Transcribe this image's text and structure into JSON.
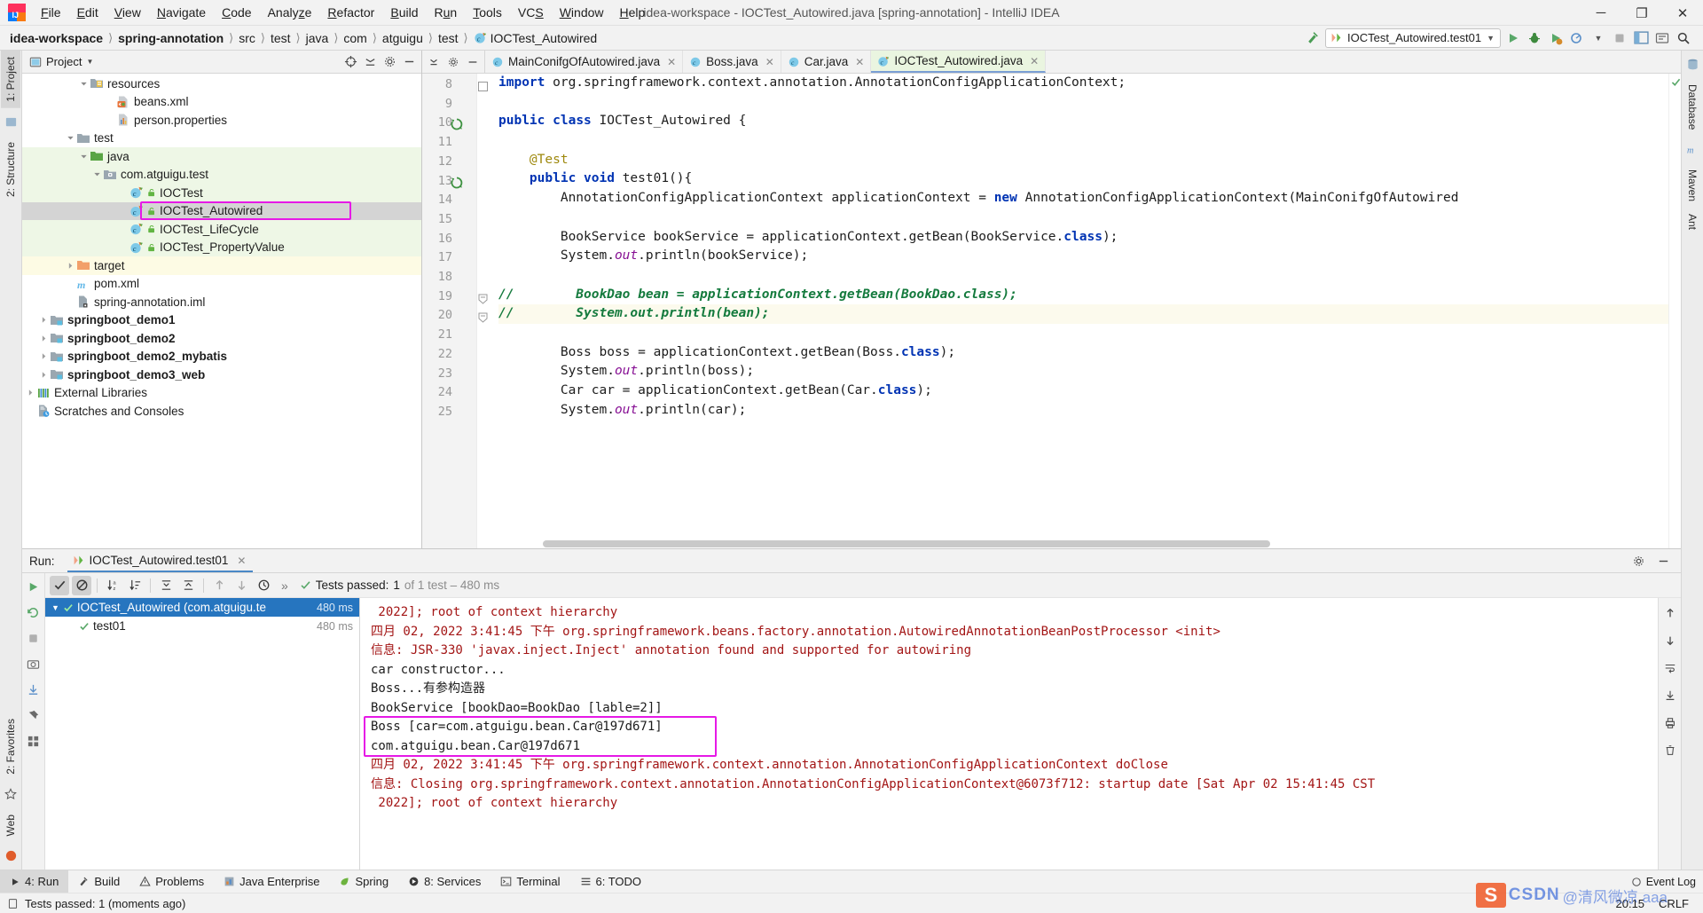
{
  "window": {
    "title": "idea-workspace - IOCTest_Autowired.java [spring-annotation] - IntelliJ IDEA",
    "minimize": "─",
    "maximize": "❐",
    "close": "✕"
  },
  "menu": [
    {
      "label": "File"
    },
    {
      "label": "Edit"
    },
    {
      "label": "View"
    },
    {
      "label": "Navigate"
    },
    {
      "label": "Code"
    },
    {
      "label": "Analyze"
    },
    {
      "label": "Refactor"
    },
    {
      "label": "Build"
    },
    {
      "label": "Run"
    },
    {
      "label": "Tools"
    },
    {
      "label": "VCS"
    },
    {
      "label": "Window"
    },
    {
      "label": "Help"
    }
  ],
  "breadcrumbs": [
    {
      "label": "idea-workspace",
      "bold": true
    },
    {
      "label": "spring-annotation",
      "bold": true
    },
    {
      "label": "src",
      "bold": false
    },
    {
      "label": "test",
      "bold": false
    },
    {
      "label": "java",
      "bold": false
    },
    {
      "label": "com",
      "bold": false
    },
    {
      "label": "atguigu",
      "bold": false
    },
    {
      "label": "test",
      "bold": false
    },
    {
      "label": "IOCTest_Autowired",
      "bold": false
    }
  ],
  "toolbar": {
    "run_config": "IOCTest_Autowired.test01",
    "icons": [
      "build-hammer-icon",
      "run-icon",
      "debug-icon",
      "run-coverage-icon",
      "profiler-icon",
      "stop-icon",
      "layout-icon",
      "settings-icon",
      "search-icon"
    ]
  },
  "left_strip": [
    {
      "label": "1: Project",
      "active": true
    },
    {
      "label": "2: Structure",
      "active": false
    },
    {
      "label": "2: Favorites",
      "active": false
    },
    {
      "label": "Web",
      "active": false
    }
  ],
  "right_strip": [
    {
      "label": "Database",
      "active": false
    },
    {
      "label": "Maven",
      "active": false
    },
    {
      "label": "Ant",
      "active": false
    }
  ],
  "bottom_strip": [
    {
      "label": "4: Run",
      "active": true
    },
    {
      "label": "Build",
      "active": false
    },
    {
      "label": "Problems",
      "active": false
    },
    {
      "label": "Java Enterprise",
      "active": false
    },
    {
      "label": "Spring",
      "active": false
    },
    {
      "label": "8: Services",
      "active": false
    },
    {
      "label": "Terminal",
      "active": false
    },
    {
      "label": "6: TODO",
      "active": false
    }
  ],
  "project": {
    "title": "Project",
    "tree": [
      {
        "label": "resources",
        "indent": 4,
        "arrow": "down",
        "icon": "folder-resources-icon",
        "bg": "white",
        "bold": false
      },
      {
        "label": "beans.xml",
        "indent": 6,
        "arrow": "none",
        "icon": "xml-file-icon",
        "bg": "white",
        "bold": false
      },
      {
        "label": "person.properties",
        "indent": 6,
        "arrow": "none",
        "icon": "properties-file-icon",
        "bg": "white",
        "bold": false
      },
      {
        "label": "test",
        "indent": 3,
        "arrow": "down",
        "icon": "folder-icon",
        "bg": "white",
        "bold": false
      },
      {
        "label": "java",
        "indent": 4,
        "arrow": "down",
        "icon": "folder-green-icon",
        "bg": "green",
        "bold": false
      },
      {
        "label": "com.atguigu.test",
        "indent": 5,
        "arrow": "down",
        "icon": "package-icon",
        "bg": "green",
        "bold": false
      },
      {
        "label": "IOCTest",
        "indent": 7,
        "arrow": "none",
        "icon": "java-test-class-icon",
        "bg": "green",
        "bold": false
      },
      {
        "label": "IOCTest_Autowired",
        "indent": 7,
        "arrow": "none",
        "icon": "java-test-class-icon",
        "bg": "selected",
        "bold": false,
        "highlight": true
      },
      {
        "label": "IOCTest_LifeCycle",
        "indent": 7,
        "arrow": "none",
        "icon": "java-test-class-icon",
        "bg": "green",
        "bold": false
      },
      {
        "label": "IOCTest_PropertyValue",
        "indent": 7,
        "arrow": "none",
        "icon": "java-test-class-icon",
        "bg": "green",
        "bold": false
      },
      {
        "label": "target",
        "indent": 3,
        "arrow": "right",
        "icon": "folder-orange-icon",
        "bg": "yellow",
        "bold": false
      },
      {
        "label": "pom.xml",
        "indent": 3,
        "arrow": "none",
        "icon": "maven-pom-icon",
        "bg": "white",
        "bold": false
      },
      {
        "label": "spring-annotation.iml",
        "indent": 3,
        "arrow": "none",
        "icon": "iml-file-icon",
        "bg": "white",
        "bold": false
      },
      {
        "label": "springboot_demo1",
        "indent": 1,
        "arrow": "right",
        "icon": "module-icon",
        "bg": "white",
        "bold": true
      },
      {
        "label": "springboot_demo2",
        "indent": 1,
        "arrow": "right",
        "icon": "module-icon",
        "bg": "white",
        "bold": true
      },
      {
        "label": "springboot_demo2_mybatis",
        "indent": 1,
        "arrow": "right",
        "icon": "module-icon",
        "bg": "white",
        "bold": true
      },
      {
        "label": "springboot_demo3_web",
        "indent": 1,
        "arrow": "right",
        "icon": "module-icon",
        "bg": "white",
        "bold": true
      },
      {
        "label": "External Libraries",
        "indent": 0,
        "arrow": "right",
        "icon": "libraries-icon",
        "bg": "white",
        "bold": false
      },
      {
        "label": "Scratches and Consoles",
        "indent": 0,
        "arrow": "none",
        "icon": "scratches-icon",
        "bg": "white",
        "bold": false
      }
    ]
  },
  "editor": {
    "tabs": [
      {
        "label": "MainConifgOfAutowired.java",
        "icon": "java-class-icon",
        "active": false
      },
      {
        "label": "Boss.java",
        "icon": "java-class-icon",
        "active": false
      },
      {
        "label": "Car.java",
        "icon": "java-class-icon",
        "active": false
      },
      {
        "label": "IOCTest_Autowired.java",
        "icon": "java-test-class-icon",
        "active": true
      }
    ],
    "first_line_number": 8,
    "lines": [
      {
        "n": 8,
        "gutter": "fold-minus",
        "text": "import org.springframework.context.annotation.AnnotationConfigApplicationContext;"
      },
      {
        "n": 9,
        "gutter": "",
        "text": ""
      },
      {
        "n": 10,
        "gutter": "run-test-icon",
        "text": "public class IOCTest_Autowired {"
      },
      {
        "n": 11,
        "gutter": "",
        "text": ""
      },
      {
        "n": 12,
        "gutter": "",
        "text": "    @Test"
      },
      {
        "n": 13,
        "gutter": "run-test-icon",
        "text": "    public void test01(){"
      },
      {
        "n": 14,
        "gutter": "",
        "text": "        AnnotationConfigApplicationContext applicationContext = new AnnotationConfigApplicationContext(MainConifgOfAutowired"
      },
      {
        "n": 15,
        "gutter": "",
        "text": ""
      },
      {
        "n": 16,
        "gutter": "",
        "text": "        BookService bookService = applicationContext.getBean(BookService.class);"
      },
      {
        "n": 17,
        "gutter": "",
        "text": "        System.out.println(bookService);"
      },
      {
        "n": 18,
        "gutter": "",
        "text": ""
      },
      {
        "n": 19,
        "gutter": "fold",
        "text": "//        BookDao bean = applicationContext.getBean(BookDao.class);"
      },
      {
        "n": 20,
        "gutter": "fold",
        "text": "//        System.out.println(bean);"
      },
      {
        "n": 21,
        "gutter": "",
        "text": ""
      },
      {
        "n": 22,
        "gutter": "",
        "text": "        Boss boss = applicationContext.getBean(Boss.class);"
      },
      {
        "n": 23,
        "gutter": "",
        "text": "        System.out.println(boss);"
      },
      {
        "n": 24,
        "gutter": "",
        "text": "        Car car = applicationContext.getBean(Car.class);"
      },
      {
        "n": 25,
        "gutter": "",
        "text": "        System.out.println(car);"
      }
    ]
  },
  "run": {
    "label": "Run:",
    "tab": "IOCTest_Autowired.test01",
    "status_prefix": "Tests passed:",
    "status_count": "1",
    "status_suffix": "of 1 test – 480 ms",
    "tree": [
      {
        "label": "IOCTest_Autowired (com.atguigu.te",
        "time": "480 ms",
        "selected": true,
        "indent": 0
      },
      {
        "label": "test01",
        "time": "480 ms",
        "selected": false,
        "indent": 1
      }
    ],
    "console": [
      {
        "text": " 2022]; root of context hierarchy",
        "color": "err",
        "box": false
      },
      {
        "text": "四月 02, 2022 3:41:45 下午 org.springframework.beans.factory.annotation.AutowiredAnnotationBeanPostProcessor <init>",
        "color": "err",
        "box": false
      },
      {
        "text": "信息: JSR-330 'javax.inject.Inject' annotation found and supported for autowiring",
        "color": "err",
        "box": false
      },
      {
        "text": "car constructor...",
        "color": "out",
        "box": false
      },
      {
        "text": "Boss...有参构造器",
        "color": "out",
        "box": false
      },
      {
        "text": "BookService [bookDao=BookDao [lable=2]]",
        "color": "out",
        "box": false
      },
      {
        "text": "Boss [car=com.atguigu.bean.Car@197d671]",
        "color": "out",
        "box": true
      },
      {
        "text": "com.atguigu.bean.Car@197d671",
        "color": "out",
        "box": true
      },
      {
        "text": "四月 02, 2022 3:41:45 下午 org.springframework.context.annotation.AnnotationConfigApplicationContext doClose",
        "color": "err",
        "box": false
      },
      {
        "text": "信息: Closing org.springframework.context.annotation.AnnotationConfigApplicationContext@6073f712: startup date [Sat Apr 02 15:41:45 CST",
        "color": "err",
        "box": false
      },
      {
        "text": " 2022]; root of context hierarchy",
        "color": "err",
        "box": false
      }
    ]
  },
  "statusbar": {
    "message": "Tests passed: 1 (moments ago)",
    "event_log": "Event Log",
    "time": "20:15",
    "line_sep": "CRLF"
  },
  "colors": {
    "highlight_box": "#e619e6",
    "selection": "#2675bf",
    "tree_green": "#eef7e6",
    "tree_yellow": "#fdfbe4",
    "console_err": "#a31515",
    "accent_blue": "#4a88c7"
  },
  "watermark": {
    "logo": "S",
    "text": "CSDN",
    "text2": "@清风微凉 aaa"
  }
}
